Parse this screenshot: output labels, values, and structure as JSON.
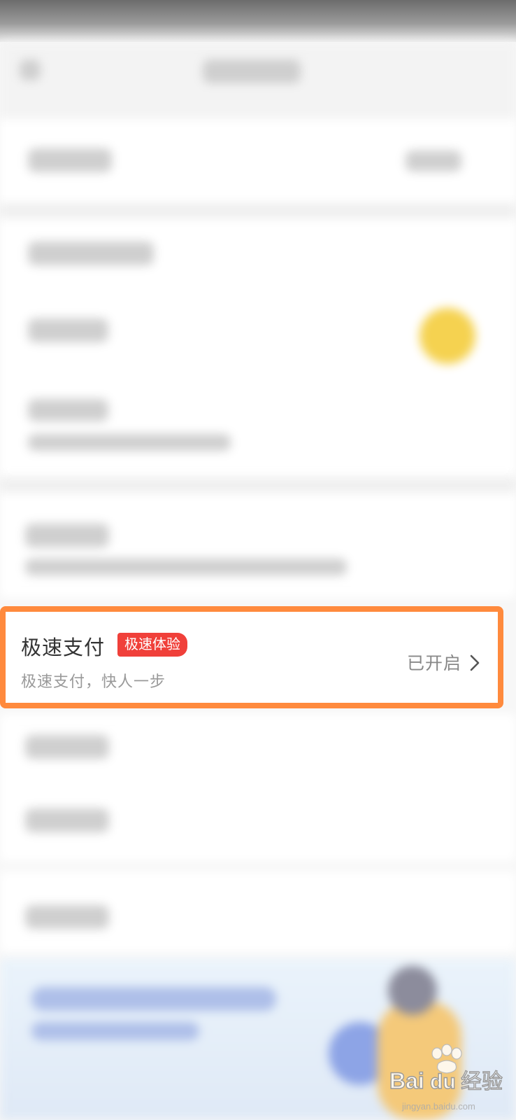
{
  "highlighted_row": {
    "title": "极速支付",
    "badge": "极速体验",
    "subtitle": "极速支付，快人一步",
    "status": "已开启"
  },
  "colors": {
    "highlight_border": "#ff8a3d",
    "badge_bg": "#f0403a",
    "toggle_yellow": "#f5d250"
  },
  "icons": {
    "chevron": "chevron-right-icon",
    "watermark": "baidu-jingyan-logo"
  },
  "watermark": {
    "brand": "Baidu经验",
    "url": "jingyan.baidu.com"
  }
}
